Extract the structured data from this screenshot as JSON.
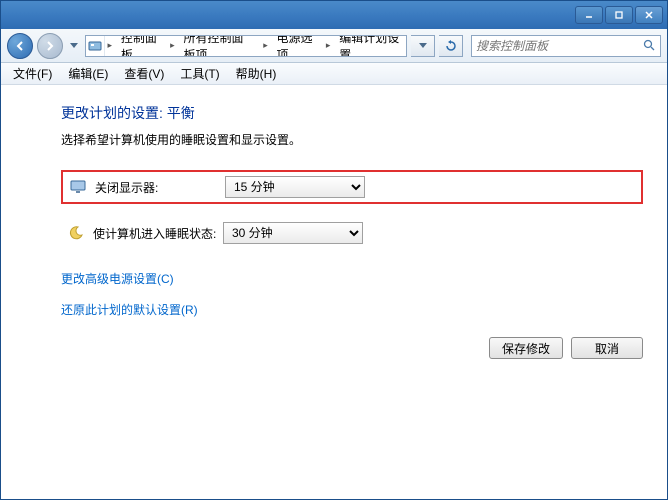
{
  "breadcrumbs": [
    "控制面板",
    "所有控制面板项",
    "电源选项",
    "编辑计划设置"
  ],
  "search": {
    "placeholder": "搜索控制面板"
  },
  "menu": [
    "文件(F)",
    "编辑(E)",
    "查看(V)",
    "工具(T)",
    "帮助(H)"
  ],
  "page": {
    "heading": "更改计划的设置: 平衡",
    "subtext": "选择希望计算机使用的睡眠设置和显示设置。",
    "display_off": {
      "label": "关闭显示器:",
      "value": "15 分钟"
    },
    "sleep": {
      "label": "使计算机进入睡眠状态:",
      "value": "30 分钟"
    },
    "link_advanced": "更改高级电源设置(C)",
    "link_restore": "还原此计划的默认设置(R)",
    "save": "保存修改",
    "cancel": "取消"
  }
}
